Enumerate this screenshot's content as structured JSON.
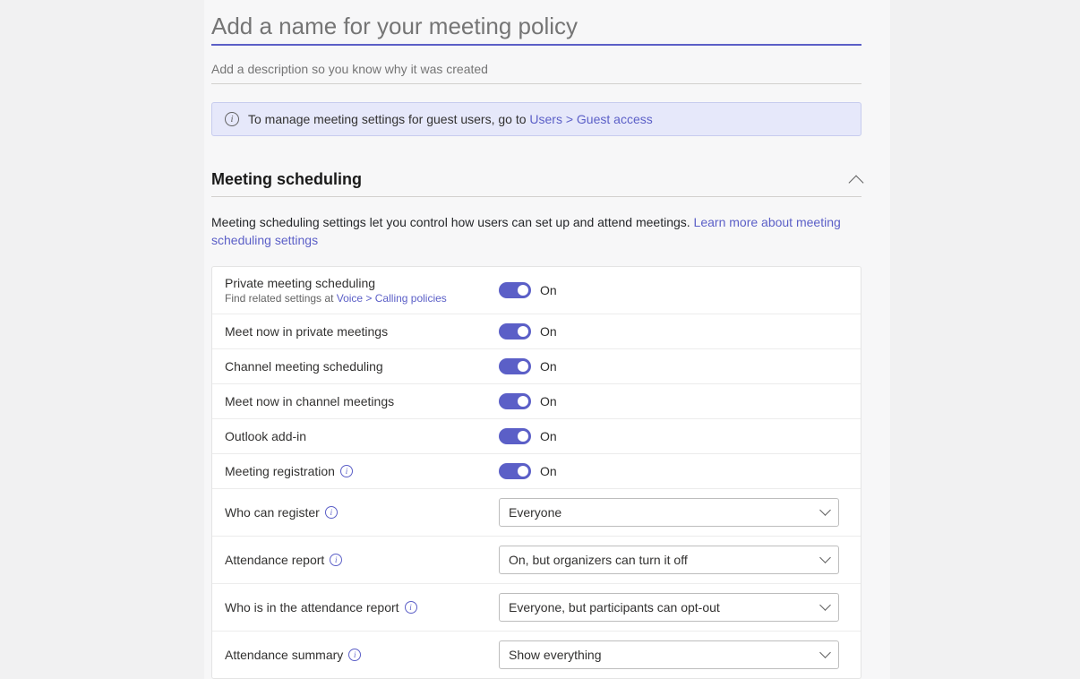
{
  "header": {
    "title_placeholder": "Add a name for your meeting policy",
    "description_placeholder": "Add a description so you know why it was created"
  },
  "banner": {
    "text": "To manage meeting settings for guest users, go to ",
    "link_text": "Users > Guest access"
  },
  "section": {
    "title": "Meeting scheduling",
    "description": "Meeting scheduling settings let you control how users can set up and attend meetings. ",
    "learn_more": "Learn more about meeting scheduling settings"
  },
  "settings": {
    "private_meeting": {
      "label": "Private meeting scheduling",
      "sublabel_prefix": "Find related settings at ",
      "sublabel_link": "Voice > Calling policies",
      "state": "On"
    },
    "meet_now_private": {
      "label": "Meet now in private meetings",
      "state": "On"
    },
    "channel_scheduling": {
      "label": "Channel meeting scheduling",
      "state": "On"
    },
    "meet_now_channel": {
      "label": "Meet now in channel meetings",
      "state": "On"
    },
    "outlook_addin": {
      "label": "Outlook add-in",
      "state": "On"
    },
    "meeting_registration": {
      "label": "Meeting registration",
      "state": "On"
    },
    "who_register": {
      "label": "Who can register",
      "value": "Everyone"
    },
    "attendance_report": {
      "label": "Attendance report",
      "value": "On, but organizers can turn it off"
    },
    "who_in_report": {
      "label": "Who is in the attendance report",
      "value": "Everyone, but participants can opt-out"
    },
    "attendance_summary": {
      "label": "Attendance summary",
      "value": "Show everything"
    }
  }
}
